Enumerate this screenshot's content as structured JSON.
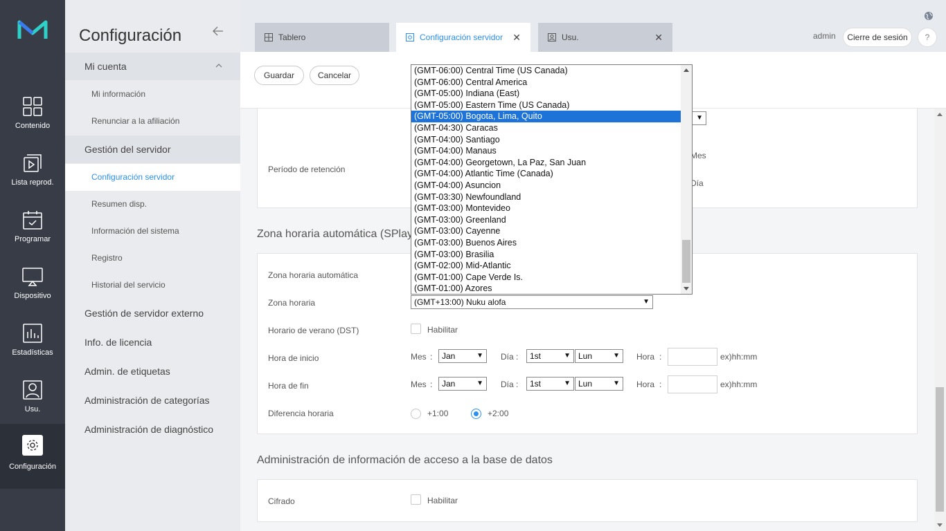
{
  "nav": {
    "items": [
      {
        "label": "Contenido",
        "icon": "grid-icon"
      },
      {
        "label": "Lista reprod.",
        "icon": "playlist-icon"
      },
      {
        "label": "Programar",
        "icon": "calendar-icon"
      },
      {
        "label": "Dispositivo",
        "icon": "monitor-icon"
      },
      {
        "label": "Estadísticas",
        "icon": "chart-icon"
      },
      {
        "label": "Usu.",
        "icon": "user-icon"
      },
      {
        "label": "Configuración",
        "icon": "gear-icon"
      }
    ]
  },
  "sidebar": {
    "title": "Configuración",
    "groups": [
      {
        "label": "Mi cuenta"
      },
      {
        "label": "Gestión del servidor"
      },
      {
        "label": "Gestión de servidor externo"
      },
      {
        "label": "Info. de licencia"
      },
      {
        "label": "Admin. de etiquetas"
      },
      {
        "label": "Administración de categorías"
      },
      {
        "label": "Administración de diagnóstico"
      }
    ],
    "subs": [
      {
        "label": "Mi información"
      },
      {
        "label": "Renunciar a la afiliación"
      },
      {
        "label": "Configuración servidor"
      },
      {
        "label": "Resumen disp."
      },
      {
        "label": "Información del sistema"
      },
      {
        "label": "Registro"
      },
      {
        "label": "Historial del servicio"
      }
    ]
  },
  "tabs": [
    {
      "label": "Tablero"
    },
    {
      "label": "Configuración servidor"
    },
    {
      "label": "Usu."
    }
  ],
  "header": {
    "user": "admin",
    "logout": "Cierre de sesión",
    "help": "?"
  },
  "toolbar": {
    "save": "Guardar",
    "cancel": "Cancelar"
  },
  "retention": {
    "label": "Período de retención",
    "month": "Mes",
    "day": "Día"
  },
  "auto_tz": {
    "section_title": "Zona horaria automática (SPlay",
    "auto_label": "Zona horaria automática",
    "tz_label": "Zona horaria",
    "tz_value": "(GMT+13:00) Nuku alofa",
    "dst_label": "Horario de verano (DST)",
    "enable": "Habilitar",
    "start_label": "Hora de inicio",
    "end_label": "Hora de fin",
    "month_lbl": "Mes",
    "day_lbl": "Día",
    "hour_lbl": "Hora",
    "colon": ":",
    "month_val": "Jan",
    "day_val": "1st",
    "weekday_val": "Lun",
    "hint": "ex)hh:mm",
    "offset_label": "Diferencia horaria",
    "offset_1": "+1:00",
    "offset_2": "+2:00"
  },
  "db": {
    "section_title": "Administración de información de acceso a la base de datos",
    "encrypt_label": "Cifrado",
    "enable": "Habilitar"
  },
  "tz_options": [
    "(GMT-06:00) Central Time (US Canada)",
    "(GMT-06:00) Central America",
    "(GMT-05:00) Indiana (East)",
    "(GMT-05:00) Eastern Time (US Canada)",
    "(GMT-05:00) Bogota, Lima, Quito",
    "(GMT-04:30) Caracas",
    "(GMT-04:00) Santiago",
    "(GMT-04:00) Manaus",
    "(GMT-04:00) Georgetown, La Paz, San Juan",
    "(GMT-04:00) Atlantic Time (Canada)",
    "(GMT-04:00) Asuncion",
    "(GMT-03:30) Newfoundland",
    "(GMT-03:00) Montevideo",
    "(GMT-03:00) Greenland",
    "(GMT-03:00) Cayenne",
    "(GMT-03:00) Buenos Aires",
    "(GMT-03:00) Brasilia",
    "(GMT-02:00) Mid-Atlantic",
    "(GMT-01:00) Cape Verde Is.",
    "(GMT-01:00) Azores"
  ],
  "tz_highlight_index": 4,
  "colors": {
    "accent": "#2b8ff0",
    "nav_bg": "#373c47",
    "highlight": "#1e73d8"
  }
}
